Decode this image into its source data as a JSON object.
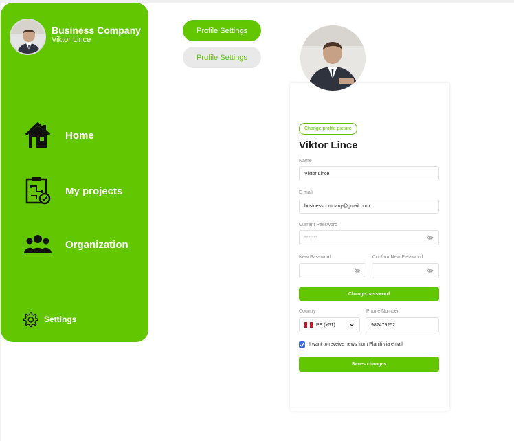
{
  "sidebar": {
    "company": "Business Company",
    "user_name": "Viktor Lince",
    "items": [
      {
        "label": "Home",
        "icon": "house-icon"
      },
      {
        "label": "My projects",
        "icon": "projects-icon"
      },
      {
        "label": "Organization",
        "icon": "group-icon"
      }
    ],
    "settings_label": "Settings",
    "accent": "#62c600"
  },
  "tabs": {
    "active_label": "Profile Settings",
    "inactive_label": "Profile Settings"
  },
  "profile": {
    "change_picture_label": "Change profile picture",
    "display_name": "Viktor Lince",
    "name_label": "Name",
    "name_value": "Viktor Lince",
    "email_label": "E-mail",
    "email_value": "businesscompany@gmail.com",
    "current_password_label": "Current Password",
    "current_password_value": "*******",
    "new_password_label": "New Password",
    "confirm_password_label": "Confirm New Password",
    "change_password_button": "Change password",
    "country_label": "Country",
    "country_value": "PE (+51)",
    "phone_label": "Phone Number",
    "phone_value": "982479252",
    "newsletter_label": "I want to reveive news from Planifi via email",
    "newsletter_checked": true,
    "save_button": "Saves changes"
  }
}
